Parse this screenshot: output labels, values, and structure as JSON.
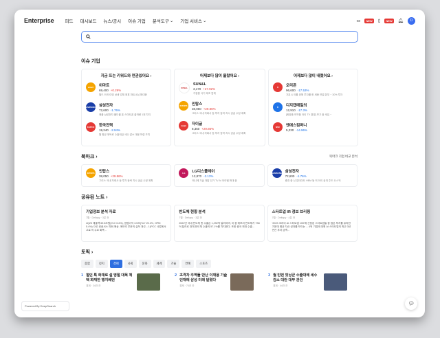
{
  "nav": {
    "logo": "Enterprise",
    "items": [
      "피드",
      "대시보드",
      "뉴스/공시",
      "이슈 기업",
      "분석도구",
      "기업 서비스"
    ],
    "new_badge": "NEW",
    "avatar": "D"
  },
  "search": {
    "placeholder": ""
  },
  "issue": {
    "title": "이슈 기업",
    "columns": [
      {
        "head": "지금 뜨는 키워드와 연관있어요",
        "companies": [
          {
            "name": "이마트",
            "price": "69,400",
            "change": "+0.29%",
            "dir": "up",
            "desc": "월드 와 타이밍 상생 업체 제휴 파트너십 확대한",
            "color": "#f5a400",
            "logo": "emart"
          },
          {
            "name": "삼성전자",
            "price": "72,600",
            "change": "-1.76%",
            "dir": "down",
            "desc": "애플 삼성전자 폴더블 폰 스마트폰 출하량 1위 차지",
            "color": "#1a3ea8",
            "logo": "SAMSUNG"
          },
          {
            "name": "한국전력",
            "price": "19,240",
            "change": "-2.94%",
            "dir": "down",
            "desc": "월 평균 위탁료 수출대금 세수 감소 대응 마련 조치",
            "color": "#e53935",
            "logo": "KEPCO"
          }
        ]
      },
      {
        "head": "어제보다 많이 올랐어요",
        "companies": [
          {
            "name": "SUN&L",
            "price": "3,170",
            "change": "+27.92%",
            "dir": "up",
            "desc": "가정용 식기 제조 업체",
            "color": "#ffffff",
            "logo": "SUN&L"
          },
          {
            "name": "인탑스",
            "price": "38,050",
            "change": "+29.86%",
            "dir": "up",
            "desc": "그리스 국내 자회사 등 투자 등락 지시 공급 수정 계획",
            "color": "#f5a400",
            "logo": "INTOPS"
          },
          {
            "name": "자이글",
            "price": "8,350",
            "change": "+29.86%",
            "dir": "up",
            "desc": "그리스 국내 자회사 등 투자 등락 지시 공급 수정 계획",
            "color": "#e53935",
            "logo": "zaigle"
          }
        ]
      },
      {
        "head": "어제보다 많이 내렸어요",
        "companies": [
          {
            "name": "오리콘",
            "price": "96,600",
            "change": "-17.53%",
            "dir": "down",
            "desc": "가온 & 이를 위해 투자를 한 세종 연결 본부 ~ 30% 투자",
            "color": "#e53935",
            "logo": "O"
          },
          {
            "name": "디지캡태일의",
            "price": "12,910",
            "change": "-17.3%",
            "dir": "down",
            "desc": "[화장품 의약품 아이 TV 경영] 보고 중 세입 ~",
            "color": "#1e73e8",
            "logo": "D"
          },
          {
            "name": "엔에스컴퍼니",
            "price": "5,230",
            "change": "-14.96%",
            "dir": "down",
            "desc": "",
            "color": "#e53935",
            "logo": "NSC"
          }
        ]
      }
    ]
  },
  "bookmark": {
    "title": "북마크",
    "link": "북마크 기업 비교 분석",
    "companies": [
      {
        "name": "인탑스",
        "price": "38,050",
        "change": "+29.86%",
        "dir": "up",
        "desc": "그리스 국내 자회사 등 투자 등락 지시 공급 수정 계획",
        "color": "#f5a400",
        "logo": "INTOPS"
      },
      {
        "name": "LG디스플레이",
        "price": "12,870",
        "change": "-2.13%",
        "dir": "down",
        "desc": "애니메 기술 개발 인가 TV AI 아이템 확대 중",
        "color": "#c2185b",
        "logo": "LG"
      },
      {
        "name": "삼성전자",
        "price": "72,600",
        "change": "-1.76%",
        "dir": "down",
        "desc": "충전 중 신 업데이트 HBM 등 의 아이 공개 주도 114 억",
        "color": "#1a3ea8",
        "logo": "SAMSUNG"
      }
    ]
  },
  "notes": {
    "title": "공유된 노트",
    "items": [
      {
        "title": "기업정보 분석 자료",
        "meta": "7월 · Deltapy · 3분 전",
        "body": "4Q23 매출액 69.8조원(YoY-3.4%), 영업이익 3.5조(YoY 20.1%, OPM 5.4%) 으로 컨센서스 하회 예상. 메모리 부문의 실적 개선... 1)PCC 사업에서 고로 의 수요 회복..."
      },
      {
        "title": "반도체 현황 분석",
        "meta": "7월 · Deltapy · 3분 전",
        "body": "2022년 국내 반도체 총 수출은 1,292억 달러이며, 이 중 메모리 반도체가 738억 달러로 전체 반도체 수출의 57.1%를 차지한다. 또한 중국 최대 수출...",
        "truncate": ""
      },
      {
        "title": "스타트업 IR 정보 브리핑",
        "meta": "7월 · Deltapy · 4분 전",
        "body": "'2023 코리아 AI 스타트업 100'에 선정된 스타트업들 중 점은 투자를 유치한 가운데 평균 자산 성과를 보이는 ... 4억 기업에 대해 AI 스타트업의 최근 3년 연간 투자 금액..."
      }
    ]
  },
  "topics": {
    "title": "토픽",
    "tabs": [
      "종합",
      "정치",
      "경제",
      "사회",
      "문화",
      "세계",
      "기술",
      "연예",
      "스포츠"
    ],
    "active_tab": "경제",
    "items": [
      {
        "num": "1",
        "title": "철인 특 화재로 설 명절 대목 체 택 화재한 행지베번",
        "meta": "경제 · 34건 관"
      },
      {
        "num": "2",
        "title": "초격차 주역들 만난 이재용 기술인재에 삼성 미래 달렸다",
        "meta": "경제 · 74건 관"
      },
      {
        "num": "3",
        "title": "월 빈번 핏닝군 수출대에 세수 감소 대란 대부 관건",
        "meta": "경제 · 44건 관"
      }
    ]
  },
  "powered": "Powered By DeepSearch"
}
